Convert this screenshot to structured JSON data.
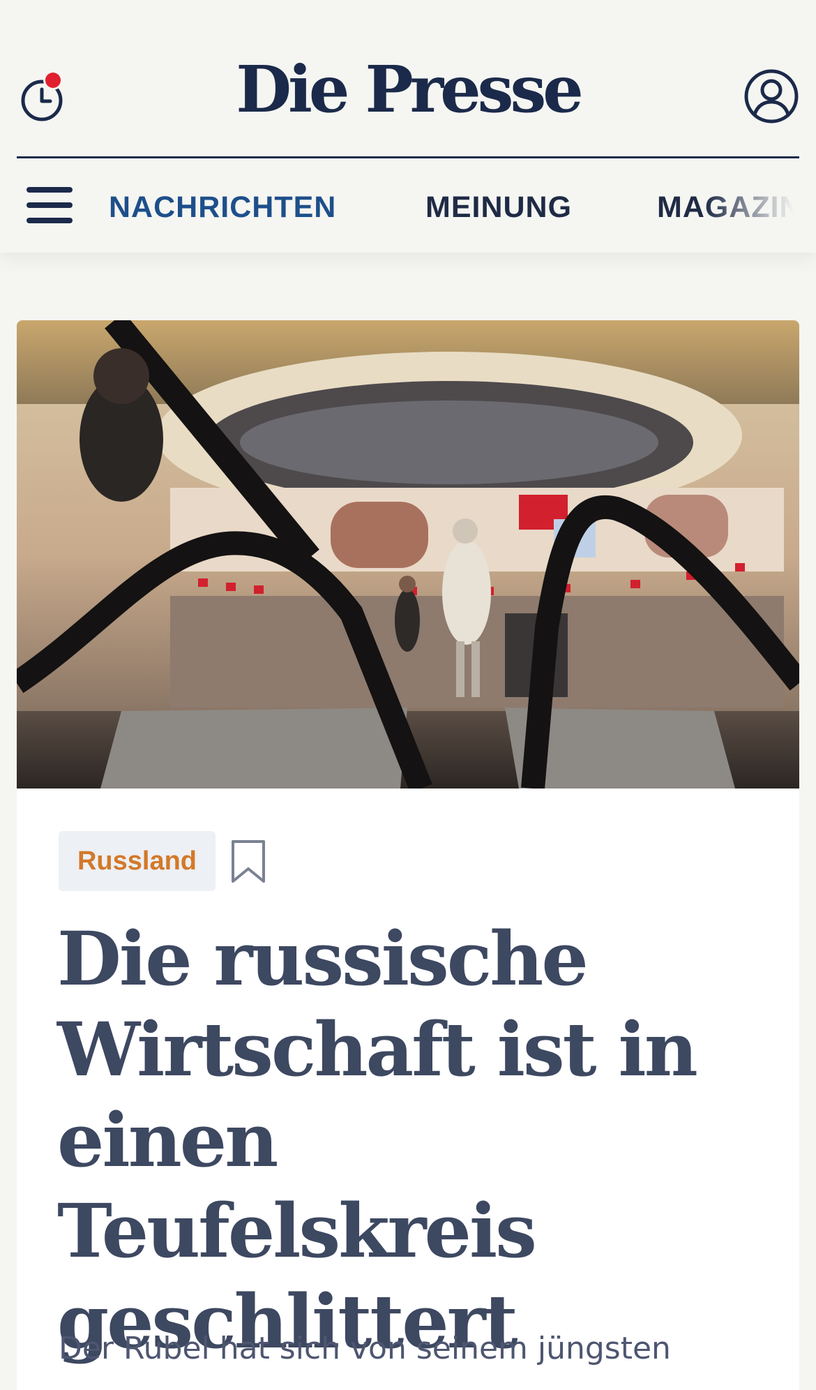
{
  "header": {
    "brand": "Die Presse",
    "history_icon": "clock-icon",
    "notification_dot_color": "#e0202e",
    "profile_icon": "user-circle-icon"
  },
  "nav": {
    "menu_icon": "hamburger-menu-icon",
    "items": [
      {
        "label": "NACHRICHTEN",
        "active": true
      },
      {
        "label": "MEINUNG",
        "active": false
      },
      {
        "label": "MAGAZIN",
        "active": false
      }
    ]
  },
  "article": {
    "category": "Russland",
    "bookmark_icon": "bookmark-icon",
    "headline": "Die russische Wirtschaft ist in einen Teufelskreis geschlittert",
    "lead": "Der Rubel hat sich von seinem jüngsten"
  },
  "colors": {
    "brand_navy": "#1b2a4a",
    "nav_active": "#1d4f8a",
    "tag_text": "#d3792a",
    "tag_bg": "#edf0f4",
    "page_bg": "#f5f5f2"
  }
}
